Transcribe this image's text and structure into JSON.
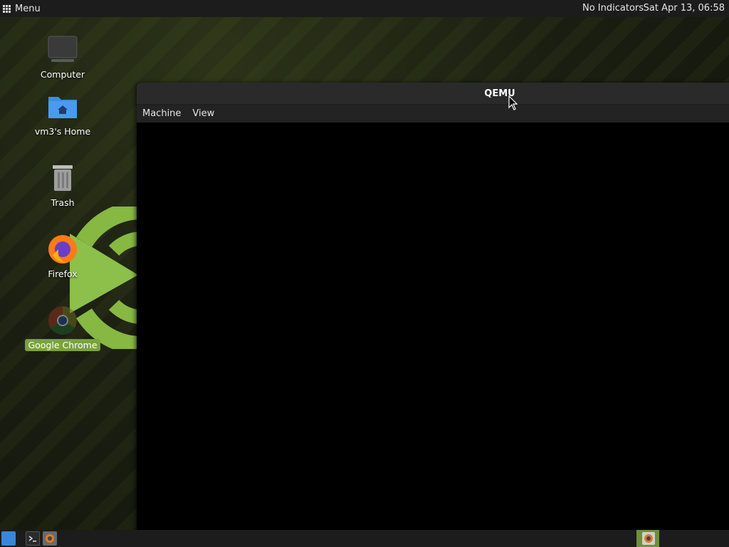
{
  "top_panel": {
    "menu_label": "Menu",
    "indicators": "No Indicators",
    "clock": "Sat Apr 13, 06:58"
  },
  "desktop": {
    "icons": [
      {
        "label": "Computer",
        "icon": "computer-icon"
      },
      {
        "label": "vm3's Home",
        "icon": "home-folder-icon"
      },
      {
        "label": "Trash",
        "icon": "trash-icon"
      },
      {
        "label": "Firefox",
        "icon": "firefox-icon"
      },
      {
        "label": "Google Chrome",
        "icon": "chrome-icon",
        "selected": true
      }
    ]
  },
  "window": {
    "title": "QEMU",
    "menu": [
      "Machine",
      "View"
    ]
  },
  "taskbar": {
    "items": [
      "show-desktop-icon",
      "terminal-icon",
      "qemu-icon"
    ],
    "active_window_icon": "qemu-icon"
  },
  "colors": {
    "accent": "#7aa33d",
    "panel": "#1c1c1c",
    "titlebar": "#2a2a2a"
  }
}
